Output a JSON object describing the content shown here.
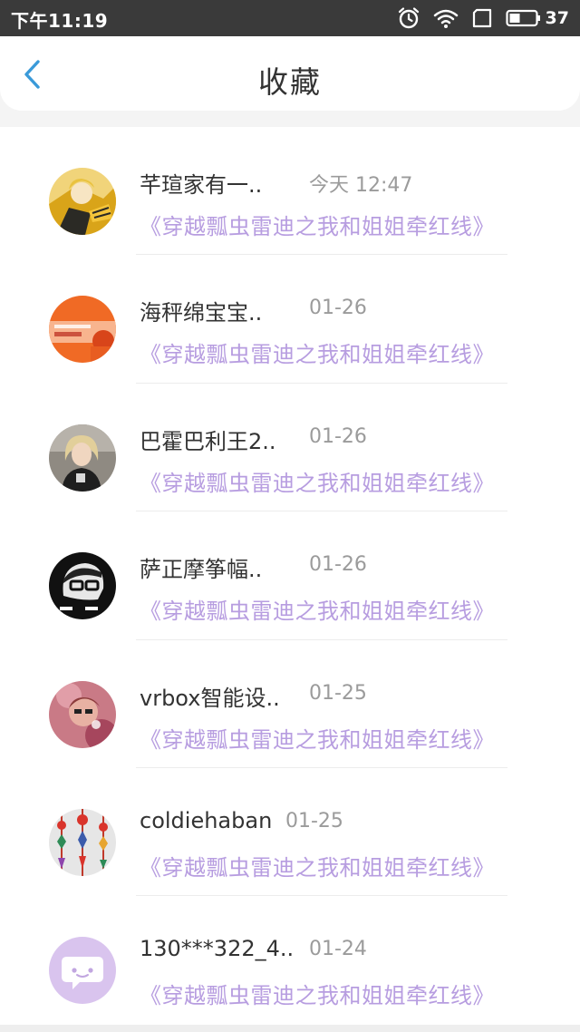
{
  "status_bar": {
    "time": "下午11:19",
    "battery": "37",
    "icons": [
      "alarm-icon",
      "wifi-icon",
      "screen-icon",
      "battery-icon"
    ]
  },
  "header": {
    "title": "收藏",
    "back_icon": "chevron-left-icon",
    "accent_color": "#3a9ad9"
  },
  "colors": {
    "book_title": "#b79de0",
    "name": "#333333",
    "time": "#9b9b9b"
  },
  "items": [
    {
      "name": "芊瑄家有一..",
      "time": "今天 12:47",
      "book": "《穿越瓢虫雷迪之我和姐姐牵红线》",
      "avatar": "avatar-bee-character"
    },
    {
      "name": "海秤绵宝宝..",
      "time": "01-26",
      "book": "《穿越瓢虫雷迪之我和姐姐牵红线》",
      "avatar": "avatar-orange-banner"
    },
    {
      "name": "巴霍巴利王2..",
      "time": "01-26",
      "book": "《穿越瓢虫雷迪之我和姐姐牵红线》",
      "avatar": "avatar-blonde-person"
    },
    {
      "name": "萨正摩筝幅..",
      "time": "01-26",
      "book": "《穿越瓢虫雷迪之我和姐姐牵红线》",
      "avatar": "avatar-glasses-bw"
    },
    {
      "name": "vrbox智能设..",
      "time": "01-25",
      "book": "《穿越瓢虫雷迪之我和姐姐牵红线》",
      "avatar": "avatar-pink-portrait"
    },
    {
      "name": "coldiehaban",
      "time": "01-25",
      "book": "《穿越瓢虫雷迪之我和姐姐牵红线》",
      "avatar": "avatar-hanging-ornaments"
    },
    {
      "name": "130***322_4..",
      "time": "01-24",
      "book": "《穿越瓢虫雷迪之我和姐姐牵红线》",
      "avatar": "avatar-default-chat"
    }
  ]
}
